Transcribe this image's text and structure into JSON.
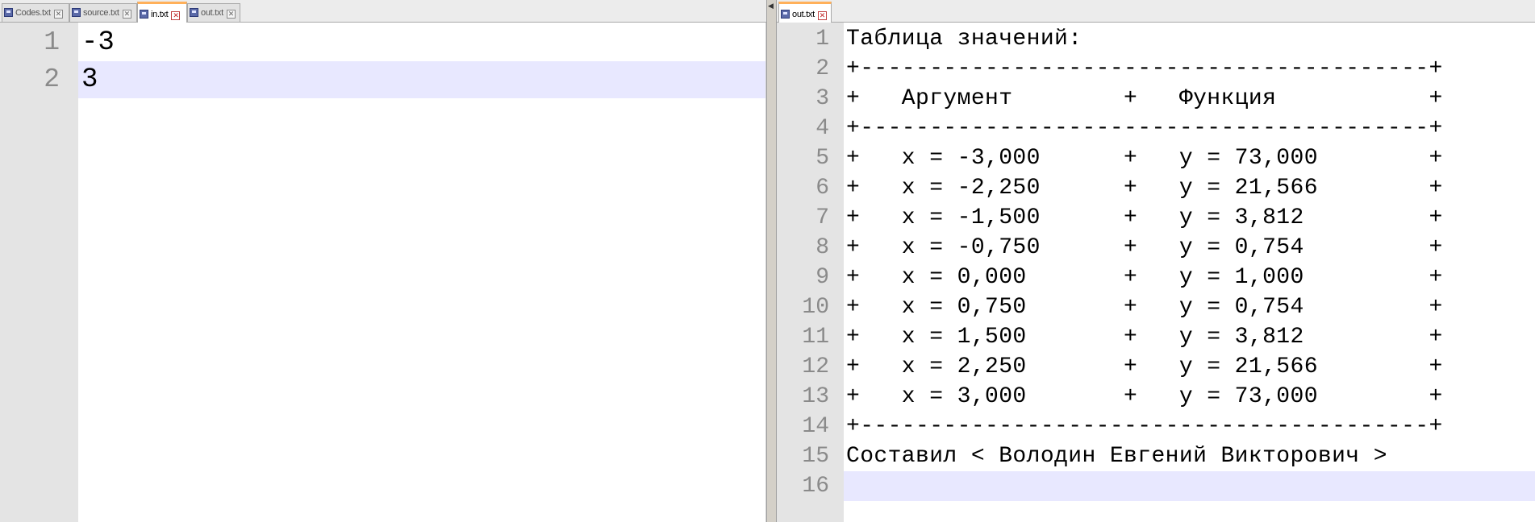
{
  "left_pane": {
    "tabs": [
      {
        "label": "Codes.txt",
        "active": false
      },
      {
        "label": "source.txt",
        "active": false
      },
      {
        "label": "in.txt",
        "active": true
      },
      {
        "label": "out.txt",
        "active": false
      }
    ],
    "lines": [
      {
        "num": "1",
        "text": "-3"
      },
      {
        "num": "2",
        "text": "3"
      }
    ],
    "current_line": 2
  },
  "right_pane": {
    "tabs": [
      {
        "label": "out.txt",
        "active": true
      }
    ],
    "lines": [
      {
        "num": "1",
        "text": "Таблица значений:"
      },
      {
        "num": "2",
        "text": "+-----------------------------------------+"
      },
      {
        "num": "3",
        "text": "+   Аргумент        +   Функция           +"
      },
      {
        "num": "4",
        "text": "+-----------------------------------------+"
      },
      {
        "num": "5",
        "text": "+   x = -3,000      +   y = 73,000        +"
      },
      {
        "num": "6",
        "text": "+   x = -2,250      +   y = 21,566        +"
      },
      {
        "num": "7",
        "text": "+   x = -1,500      +   y = 3,812         +"
      },
      {
        "num": "8",
        "text": "+   x = -0,750      +   y = 0,754         +"
      },
      {
        "num": "9",
        "text": "+   x = 0,000       +   y = 1,000         +"
      },
      {
        "num": "10",
        "text": "+   x = 0,750       +   y = 0,754         +"
      },
      {
        "num": "11",
        "text": "+   x = 1,500       +   y = 3,812         +"
      },
      {
        "num": "12",
        "text": "+   x = 2,250       +   y = 21,566        +"
      },
      {
        "num": "13",
        "text": "+   x = 3,000       +   y = 73,000        +"
      },
      {
        "num": "14",
        "text": "+-----------------------------------------+"
      },
      {
        "num": "15",
        "text": "Составил < Володин Евгений Викторович >"
      },
      {
        "num": "16",
        "text": ""
      }
    ],
    "current_line": 16
  },
  "colors": {
    "current_line_highlight": "#e8e8ff",
    "gutter": "#e4e4e4",
    "active_tab_accent": "#ffb05a",
    "tab_icon": "#5b6aa8"
  },
  "icons": {
    "tab_file": "file-icon",
    "tab_close": "close-icon",
    "splitter_arrow": "arrow-left-icon"
  }
}
